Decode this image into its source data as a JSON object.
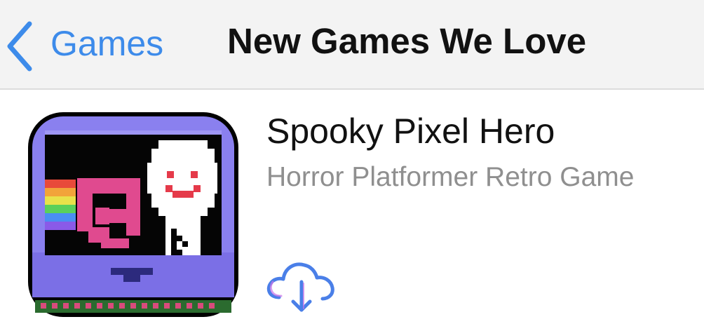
{
  "navigation": {
    "back_label": "Games",
    "back_icon": "chevron-left-icon",
    "title": "New Games We Love"
  },
  "app": {
    "name": "Spooky Pixel Hero",
    "subtitle": "Horror Platformer Retro Game",
    "icon": "game-app-icon",
    "action_icon": "cloud-download-icon"
  },
  "colors": {
    "accent": "#3d8bea",
    "title_text": "#111111",
    "subtitle_text": "#8f8f8f",
    "navbar_bg": "#f3f3f3",
    "icon_frame": "#8a7ef0",
    "icon_screen": "#000000",
    "icon_pink": "#e04a8f"
  }
}
